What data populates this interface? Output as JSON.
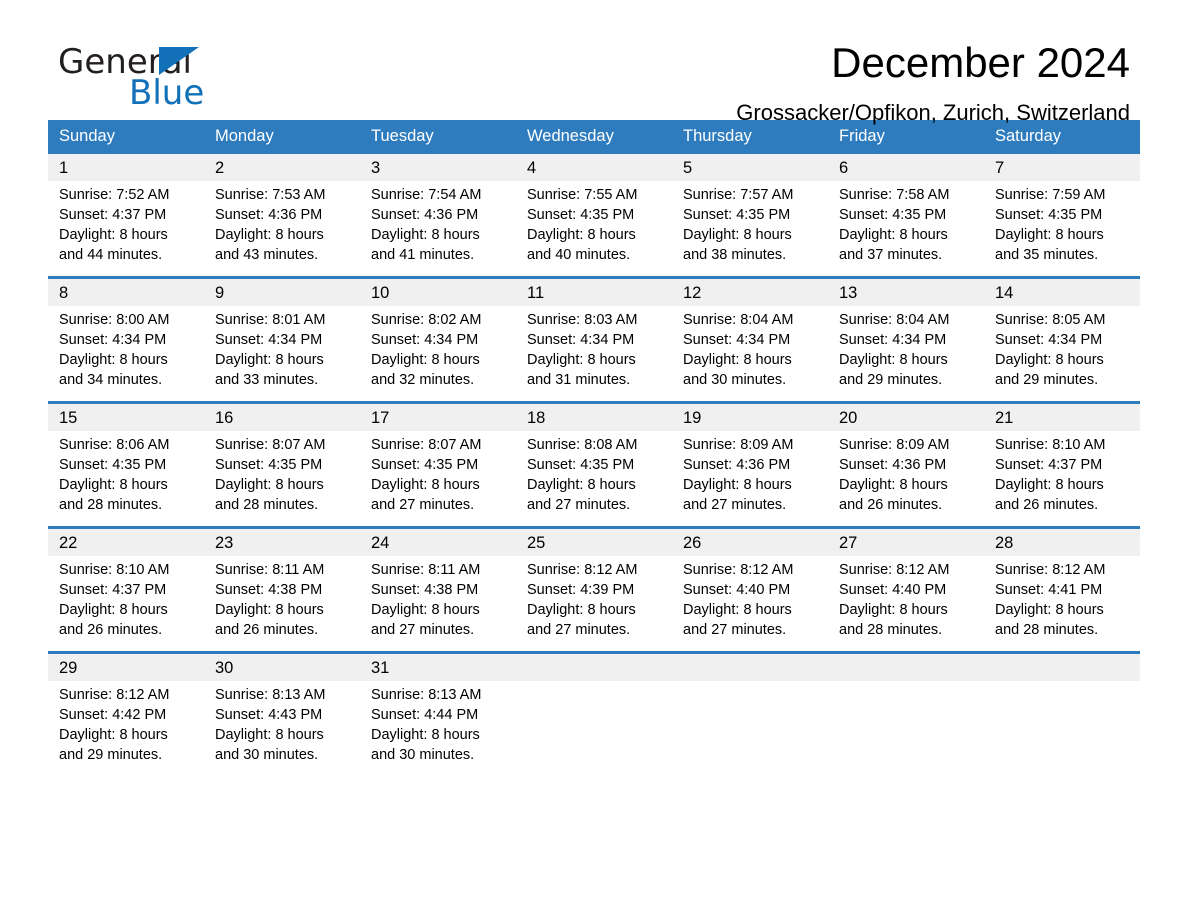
{
  "brand": {
    "line1": "General",
    "line2": "Blue",
    "accent_color": "#1271b8"
  },
  "header": {
    "month_title": "December 2024",
    "location": "Grossacker/Opfikon, Zurich, Switzerland"
  },
  "calendar": {
    "header_color": "#2e7cbe",
    "daynum_band_color": "#f0f0f0",
    "weekdays": [
      "Sunday",
      "Monday",
      "Tuesday",
      "Wednesday",
      "Thursday",
      "Friday",
      "Saturday"
    ],
    "weeks": [
      {
        "days": [
          {
            "num": "1",
            "sunrise": "Sunrise: 7:52 AM",
            "sunset": "Sunset: 4:37 PM",
            "daylight1": "Daylight: 8 hours",
            "daylight2": "and 44 minutes."
          },
          {
            "num": "2",
            "sunrise": "Sunrise: 7:53 AM",
            "sunset": "Sunset: 4:36 PM",
            "daylight1": "Daylight: 8 hours",
            "daylight2": "and 43 minutes."
          },
          {
            "num": "3",
            "sunrise": "Sunrise: 7:54 AM",
            "sunset": "Sunset: 4:36 PM",
            "daylight1": "Daylight: 8 hours",
            "daylight2": "and 41 minutes."
          },
          {
            "num": "4",
            "sunrise": "Sunrise: 7:55 AM",
            "sunset": "Sunset: 4:35 PM",
            "daylight1": "Daylight: 8 hours",
            "daylight2": "and 40 minutes."
          },
          {
            "num": "5",
            "sunrise": "Sunrise: 7:57 AM",
            "sunset": "Sunset: 4:35 PM",
            "daylight1": "Daylight: 8 hours",
            "daylight2": "and 38 minutes."
          },
          {
            "num": "6",
            "sunrise": "Sunrise: 7:58 AM",
            "sunset": "Sunset: 4:35 PM",
            "daylight1": "Daylight: 8 hours",
            "daylight2": "and 37 minutes."
          },
          {
            "num": "7",
            "sunrise": "Sunrise: 7:59 AM",
            "sunset": "Sunset: 4:35 PM",
            "daylight1": "Daylight: 8 hours",
            "daylight2": "and 35 minutes."
          }
        ]
      },
      {
        "days": [
          {
            "num": "8",
            "sunrise": "Sunrise: 8:00 AM",
            "sunset": "Sunset: 4:34 PM",
            "daylight1": "Daylight: 8 hours",
            "daylight2": "and 34 minutes."
          },
          {
            "num": "9",
            "sunrise": "Sunrise: 8:01 AM",
            "sunset": "Sunset: 4:34 PM",
            "daylight1": "Daylight: 8 hours",
            "daylight2": "and 33 minutes."
          },
          {
            "num": "10",
            "sunrise": "Sunrise: 8:02 AM",
            "sunset": "Sunset: 4:34 PM",
            "daylight1": "Daylight: 8 hours",
            "daylight2": "and 32 minutes."
          },
          {
            "num": "11",
            "sunrise": "Sunrise: 8:03 AM",
            "sunset": "Sunset: 4:34 PM",
            "daylight1": "Daylight: 8 hours",
            "daylight2": "and 31 minutes."
          },
          {
            "num": "12",
            "sunrise": "Sunrise: 8:04 AM",
            "sunset": "Sunset: 4:34 PM",
            "daylight1": "Daylight: 8 hours",
            "daylight2": "and 30 minutes."
          },
          {
            "num": "13",
            "sunrise": "Sunrise: 8:04 AM",
            "sunset": "Sunset: 4:34 PM",
            "daylight1": "Daylight: 8 hours",
            "daylight2": "and 29 minutes."
          },
          {
            "num": "14",
            "sunrise": "Sunrise: 8:05 AM",
            "sunset": "Sunset: 4:34 PM",
            "daylight1": "Daylight: 8 hours",
            "daylight2": "and 29 minutes."
          }
        ]
      },
      {
        "days": [
          {
            "num": "15",
            "sunrise": "Sunrise: 8:06 AM",
            "sunset": "Sunset: 4:35 PM",
            "daylight1": "Daylight: 8 hours",
            "daylight2": "and 28 minutes."
          },
          {
            "num": "16",
            "sunrise": "Sunrise: 8:07 AM",
            "sunset": "Sunset: 4:35 PM",
            "daylight1": "Daylight: 8 hours",
            "daylight2": "and 28 minutes."
          },
          {
            "num": "17",
            "sunrise": "Sunrise: 8:07 AM",
            "sunset": "Sunset: 4:35 PM",
            "daylight1": "Daylight: 8 hours",
            "daylight2": "and 27 minutes."
          },
          {
            "num": "18",
            "sunrise": "Sunrise: 8:08 AM",
            "sunset": "Sunset: 4:35 PM",
            "daylight1": "Daylight: 8 hours",
            "daylight2": "and 27 minutes."
          },
          {
            "num": "19",
            "sunrise": "Sunrise: 8:09 AM",
            "sunset": "Sunset: 4:36 PM",
            "daylight1": "Daylight: 8 hours",
            "daylight2": "and 27 minutes."
          },
          {
            "num": "20",
            "sunrise": "Sunrise: 8:09 AM",
            "sunset": "Sunset: 4:36 PM",
            "daylight1": "Daylight: 8 hours",
            "daylight2": "and 26 minutes."
          },
          {
            "num": "21",
            "sunrise": "Sunrise: 8:10 AM",
            "sunset": "Sunset: 4:37 PM",
            "daylight1": "Daylight: 8 hours",
            "daylight2": "and 26 minutes."
          }
        ]
      },
      {
        "days": [
          {
            "num": "22",
            "sunrise": "Sunrise: 8:10 AM",
            "sunset": "Sunset: 4:37 PM",
            "daylight1": "Daylight: 8 hours",
            "daylight2": "and 26 minutes."
          },
          {
            "num": "23",
            "sunrise": "Sunrise: 8:11 AM",
            "sunset": "Sunset: 4:38 PM",
            "daylight1": "Daylight: 8 hours",
            "daylight2": "and 26 minutes."
          },
          {
            "num": "24",
            "sunrise": "Sunrise: 8:11 AM",
            "sunset": "Sunset: 4:38 PM",
            "daylight1": "Daylight: 8 hours",
            "daylight2": "and 27 minutes."
          },
          {
            "num": "25",
            "sunrise": "Sunrise: 8:12 AM",
            "sunset": "Sunset: 4:39 PM",
            "daylight1": "Daylight: 8 hours",
            "daylight2": "and 27 minutes."
          },
          {
            "num": "26",
            "sunrise": "Sunrise: 8:12 AM",
            "sunset": "Sunset: 4:40 PM",
            "daylight1": "Daylight: 8 hours",
            "daylight2": "and 27 minutes."
          },
          {
            "num": "27",
            "sunrise": "Sunrise: 8:12 AM",
            "sunset": "Sunset: 4:40 PM",
            "daylight1": "Daylight: 8 hours",
            "daylight2": "and 28 minutes."
          },
          {
            "num": "28",
            "sunrise": "Sunrise: 8:12 AM",
            "sunset": "Sunset: 4:41 PM",
            "daylight1": "Daylight: 8 hours",
            "daylight2": "and 28 minutes."
          }
        ]
      },
      {
        "days": [
          {
            "num": "29",
            "sunrise": "Sunrise: 8:12 AM",
            "sunset": "Sunset: 4:42 PM",
            "daylight1": "Daylight: 8 hours",
            "daylight2": "and 29 minutes."
          },
          {
            "num": "30",
            "sunrise": "Sunrise: 8:13 AM",
            "sunset": "Sunset: 4:43 PM",
            "daylight1": "Daylight: 8 hours",
            "daylight2": "and 30 minutes."
          },
          {
            "num": "31",
            "sunrise": "Sunrise: 8:13 AM",
            "sunset": "Sunset: 4:44 PM",
            "daylight1": "Daylight: 8 hours",
            "daylight2": "and 30 minutes."
          },
          {
            "num": "",
            "sunrise": "",
            "sunset": "",
            "daylight1": "",
            "daylight2": ""
          },
          {
            "num": "",
            "sunrise": "",
            "sunset": "",
            "daylight1": "",
            "daylight2": ""
          },
          {
            "num": "",
            "sunrise": "",
            "sunset": "",
            "daylight1": "",
            "daylight2": ""
          },
          {
            "num": "",
            "sunrise": "",
            "sunset": "",
            "daylight1": "",
            "daylight2": ""
          }
        ]
      }
    ]
  }
}
